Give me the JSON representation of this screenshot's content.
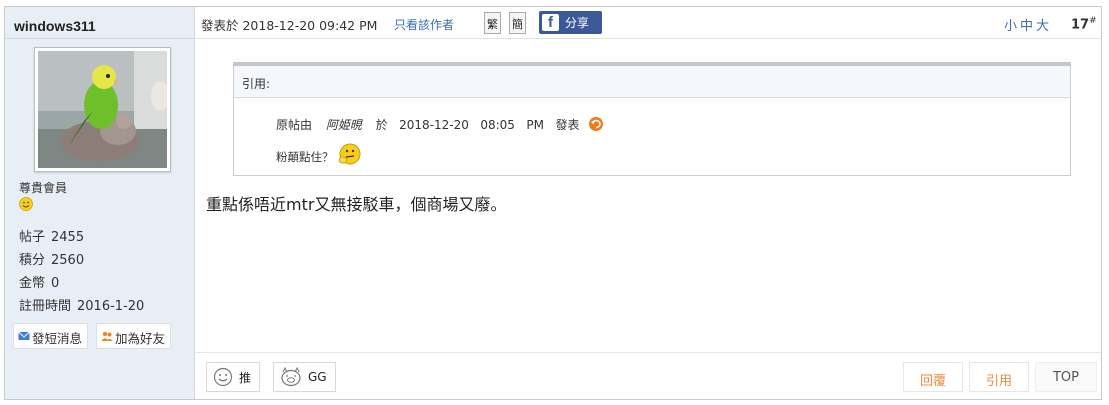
{
  "user": {
    "name": "windows311",
    "rank": "尊貴會員",
    "stats": [
      {
        "label": "帖子",
        "value": "2455"
      },
      {
        "label": "積分",
        "value": "2560"
      },
      {
        "label": "金幣",
        "value": "0"
      },
      {
        "label": "註冊時間",
        "value": "2016-1-20"
      }
    ],
    "pm_label": "發短消息",
    "friend_label": "加為好友"
  },
  "post": {
    "meta": "發表於 2018-12-20 09:42 PM",
    "author_only": "只看該作者",
    "trad_label": "繁",
    "simp_label": "簡",
    "share_label": "分享",
    "font_sizes": "小中大",
    "floor": "17",
    "floor_sup": "#",
    "quote": {
      "header": "引用:",
      "prefix": "原帖由",
      "poster": "阿姫晛",
      "at": "於",
      "date": "2018-12-20",
      "time": "08:05",
      "ampm": "PM",
      "suffix": "發表",
      "text": "粉顛點住？"
    },
    "body": "重點係唔近mtr又無接駁車，個商場又廢。"
  },
  "actions": {
    "push_label": "推",
    "gg_label": "GG",
    "reply_label": "回覆",
    "quote_label": "引用",
    "top_label": "TOP"
  },
  "colors": {
    "link": "#3d6db3",
    "facebook": "#3b5998",
    "action_orange": "#f08a3a",
    "sidebar_bg": "#e8eef6"
  }
}
